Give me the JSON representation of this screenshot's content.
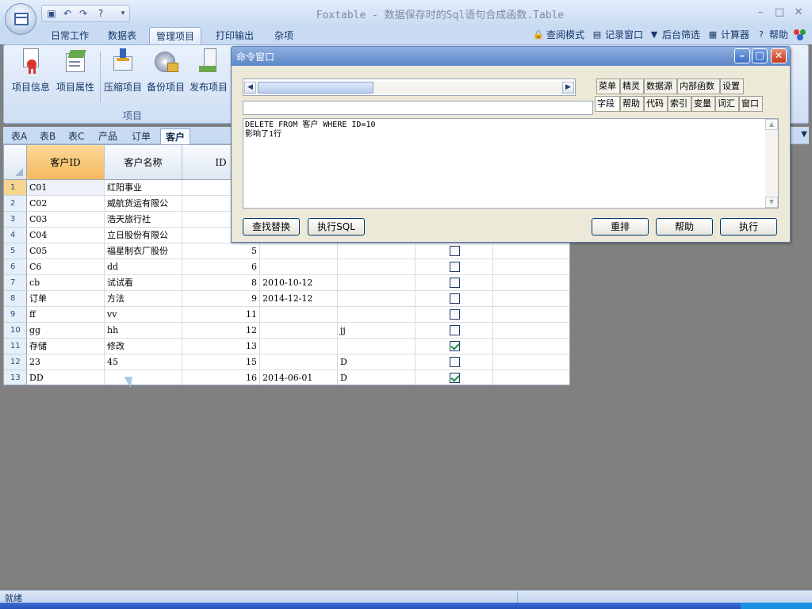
{
  "window": {
    "title": "Foxtable - 数据保存时的Sql语句合成函数.Table"
  },
  "ribbon": {
    "tabs": [
      "日常工作",
      "数据表",
      "管理项目",
      "打印输出",
      "杂项"
    ],
    "active_tab": "管理项目",
    "tools": [
      "查阅模式",
      "记录窗口",
      "后台筛选",
      "计算器",
      "帮助"
    ],
    "buttons": [
      "项目信息",
      "项目属性",
      "压缩项目",
      "备份项目",
      "发布项目"
    ],
    "group_label": "项目"
  },
  "sheet_tabs": {
    "items": [
      "表A",
      "表B",
      "表C",
      "产品",
      "订单",
      "客户"
    ],
    "active": "客户"
  },
  "grid": {
    "columns": [
      "客户ID",
      "客户名称",
      "ID"
    ],
    "rows": [
      {
        "n": "1",
        "c1": "C01",
        "c2": "红阳事业",
        "c3": "",
        "c4": "",
        "c5": "",
        "chk": null
      },
      {
        "n": "2",
        "c1": "C02",
        "c2": "威航货运有限公",
        "c3": "",
        "c4": "",
        "c5": "",
        "chk": null
      },
      {
        "n": "3",
        "c1": "C03",
        "c2": "浩天旅行社",
        "c3": "",
        "c4": "",
        "c5": "",
        "chk": null
      },
      {
        "n": "4",
        "c1": "C04",
        "c2": "立日股份有限公",
        "c3": "",
        "c4": "",
        "c5": "",
        "chk": null
      },
      {
        "n": "5",
        "c1": "C05",
        "c2": "福星制衣厂股份",
        "c3": "5",
        "c4": "",
        "c5": "",
        "chk": false
      },
      {
        "n": "6",
        "c1": "C6",
        "c2": "dd",
        "c3": "6",
        "c4": "",
        "c5": "",
        "chk": false
      },
      {
        "n": "7",
        "c1": "cb",
        "c2": "试试看",
        "c3": "8",
        "c4": "2010-10-12",
        "c5": "",
        "chk": false
      },
      {
        "n": "8",
        "c1": "订单",
        "c2": "方法",
        "c3": "9",
        "c4": "2014-12-12",
        "c5": "",
        "chk": false
      },
      {
        "n": "9",
        "c1": "ff",
        "c2": "vv",
        "c3": "11",
        "c4": "",
        "c5": "",
        "chk": false
      },
      {
        "n": "10",
        "c1": "gg",
        "c2": "hh",
        "c3": "12",
        "c4": "",
        "c5": "jj",
        "chk": false
      },
      {
        "n": "11",
        "c1": "存储",
        "c2": "修改",
        "c3": "13",
        "c4": "",
        "c5": "",
        "chk": true
      },
      {
        "n": "12",
        "c1": "23",
        "c2": "45",
        "c3": "15",
        "c4": "",
        "c5": "D",
        "chk": false
      },
      {
        "n": "13",
        "c1": "DD",
        "c2": "",
        "c3": "16",
        "c4": "2014-06-01",
        "c5": "D",
        "chk": true
      }
    ]
  },
  "command_window": {
    "title": "命令窗口",
    "tabs_row1": [
      "菜单",
      "精灵",
      "数据源",
      "内部函数",
      "设置"
    ],
    "tabs_row2": [
      "字段",
      "帮助",
      "代码",
      "索引",
      "变量",
      "词汇",
      "窗口"
    ],
    "active_tab": "字段",
    "output": [
      "DELETE FROM 客户 WHERE ID=10",
      "影响了1行"
    ],
    "buttons": {
      "find_replace": "查找替换",
      "exec_sql": "执行SQL",
      "rearrange": "重排",
      "help": "帮助",
      "execute": "执行"
    }
  },
  "status": {
    "text": "就绪"
  },
  "colors": {
    "accent": "#c9dbf2",
    "title_blue": "#5d87c8",
    "selected_header": "#f4b95e"
  },
  "icons": [
    "app-orb-icon",
    "save-icon",
    "undo-icon",
    "redo-icon",
    "help-icon",
    "lock-icon",
    "record-window-icon",
    "filter-icon",
    "calculator-icon",
    "help-circle-icon"
  ]
}
